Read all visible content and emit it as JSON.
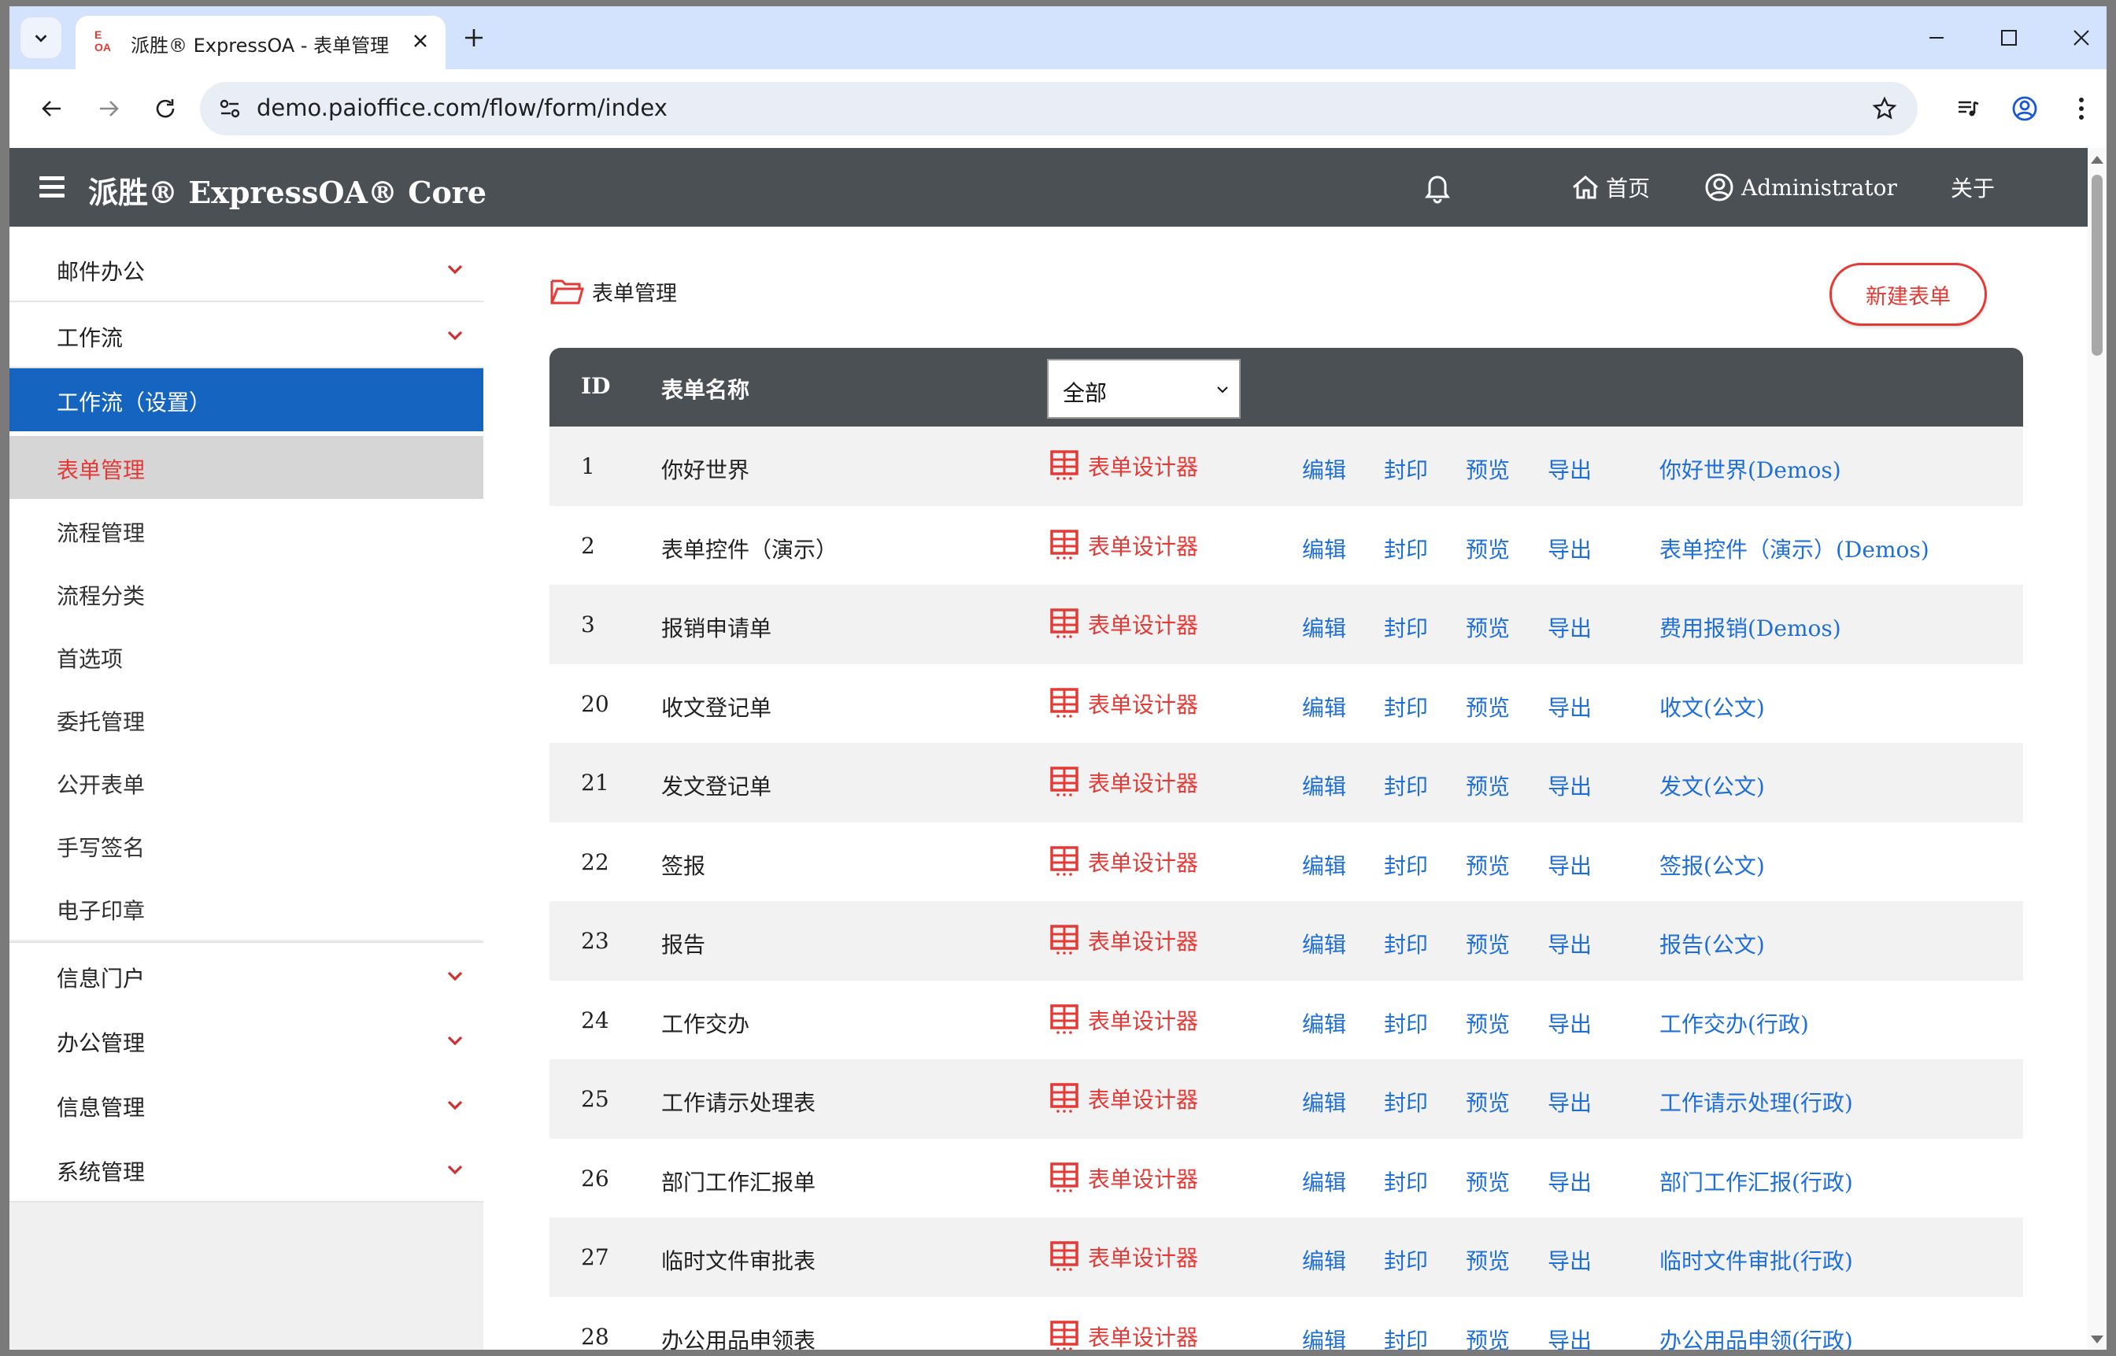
{
  "browser": {
    "tab_title": "派胜® ExpressOA - 表单管理",
    "favicon_text": "E OA",
    "url": "demo.paioffice.com/flow/form/index"
  },
  "app": {
    "brand": "派胜® ExpressOA® Core",
    "nav": {
      "home": "首页",
      "user": "Administrator",
      "about": "关于"
    }
  },
  "sidebar": {
    "groups_top": [
      "邮件办公",
      "工作流"
    ],
    "active_section": "工作流（设置）",
    "sub_items": [
      "表单管理",
      "流程管理",
      "流程分类",
      "首选项",
      "委托管理",
      "公开表单",
      "手写签名",
      "电子印章"
    ],
    "selected_sub_index": 0,
    "groups_bottom": [
      "信息门户",
      "办公管理",
      "信息管理",
      "系统管理"
    ]
  },
  "main": {
    "breadcrumb": "表单管理",
    "new_button": "新建表单",
    "table": {
      "headers": {
        "id": "ID",
        "name": "表单名称"
      },
      "filter_value": "全部",
      "designer_label": "表单设计器",
      "actions": {
        "edit": "编辑",
        "seal": "封印",
        "preview": "预览",
        "export": "导出"
      },
      "rows": [
        {
          "id": "1",
          "name": "你好世界",
          "demo": "你好世界(Demos)"
        },
        {
          "id": "2",
          "name": "表单控件（演示）",
          "demo": "表单控件（演示）(Demos)"
        },
        {
          "id": "3",
          "name": "报销申请单",
          "demo": "费用报销(Demos)"
        },
        {
          "id": "20",
          "name": "收文登记单",
          "demo": "收文(公文)"
        },
        {
          "id": "21",
          "name": "发文登记单",
          "demo": "发文(公文)"
        },
        {
          "id": "22",
          "name": "签报",
          "demo": "签报(公文)"
        },
        {
          "id": "23",
          "name": "报告",
          "demo": "报告(公文)"
        },
        {
          "id": "24",
          "name": "工作交办",
          "demo": "工作交办(行政)"
        },
        {
          "id": "25",
          "name": "工作请示处理表",
          "demo": "工作请示处理(行政)"
        },
        {
          "id": "26",
          "name": "部门工作汇报单",
          "demo": "部门工作汇报(行政)"
        },
        {
          "id": "27",
          "name": "临时文件审批表",
          "demo": "临时文件审批(行政)"
        },
        {
          "id": "28",
          "name": "办公用品申领表",
          "demo": "办公用品申领(行政)"
        }
      ]
    }
  },
  "colors": {
    "appbar": "#4b5055",
    "active": "#1565c0",
    "accent": "#e53935",
    "link": "#1e6fd9"
  },
  "icons": [
    "chevron-down-icon",
    "close-icon",
    "plus-icon",
    "minimize-icon",
    "maximize-icon",
    "back-icon",
    "forward-icon",
    "reload-icon",
    "site-settings-icon",
    "star-icon",
    "media-icon",
    "profile-icon",
    "more-icon",
    "menu-icon",
    "bell-icon",
    "home-icon",
    "user-icon",
    "folder-icon",
    "form-designer-icon"
  ]
}
